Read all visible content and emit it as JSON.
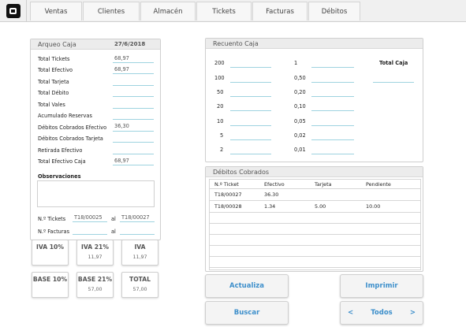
{
  "nav": {
    "tabs": [
      "Ventas",
      "Clientes",
      "Almacén",
      "Tickets",
      "Facturas",
      "Débitos"
    ]
  },
  "arqueo": {
    "title": "Arqueo Caja",
    "date": "27/6/2018",
    "rows": [
      {
        "label": "Total Tickets",
        "value": "68,97"
      },
      {
        "label": "Total Efectivo",
        "value": "68,97"
      },
      {
        "label": "Total Tarjeta",
        "value": ""
      },
      {
        "label": "Total Débito",
        "value": ""
      },
      {
        "label": "Total Vales",
        "value": ""
      },
      {
        "label": "Acumulado Reservas",
        "value": ""
      },
      {
        "label": "Débitos Cobrados Efectivo",
        "value": "36,30"
      },
      {
        "label": "Débitos Cobrados Tarjeta",
        "value": ""
      },
      {
        "label": "Retirada Efectivo",
        "value": ""
      },
      {
        "label": "Total Efectivo Caja",
        "value": "68,97"
      }
    ],
    "observaciones_label": "Observaciones",
    "tickets_label": "N.º Tickets",
    "tickets_from": "T18/00025",
    "al_label": "al",
    "tickets_to": "T18/00027",
    "facturas_label": "N.º Facturas",
    "facturas_from": "",
    "facturas_to": ""
  },
  "iva_boxes": [
    {
      "title": "IVA 10%",
      "value": ""
    },
    {
      "title": "IVA 21%",
      "value": "11,97"
    },
    {
      "title": "IVA",
      "value": "11,97"
    },
    {
      "title": "BASE 10%",
      "value": ""
    },
    {
      "title": "BASE 21%",
      "value": "57,00"
    },
    {
      "title": "TOTAL",
      "value": "57,00"
    }
  ],
  "recuento": {
    "title": "Recuento Caja",
    "col1": [
      "200",
      "100",
      "50",
      "20",
      "10",
      "5",
      "2"
    ],
    "col2": [
      "1",
      "0,50",
      "0,20",
      "0,10",
      "0,05",
      "0,02",
      "0,01"
    ],
    "total_label": "Total Caja"
  },
  "debitos": {
    "title": "Débitos Cobrados",
    "headers": [
      "N.º Ticket",
      "Efectivo",
      "Tarjeta",
      "Pendiente"
    ],
    "rows": [
      [
        "T18/00027",
        "36.30",
        "",
        ""
      ],
      [
        "T18/00028",
        "1.34",
        "5.00",
        "10.00"
      ]
    ]
  },
  "buttons": {
    "actualiza": "Actualiza",
    "imprimir": "Imprimir",
    "buscar": "Buscar",
    "todos": "Todos",
    "prev": "<",
    "next": ">"
  }
}
